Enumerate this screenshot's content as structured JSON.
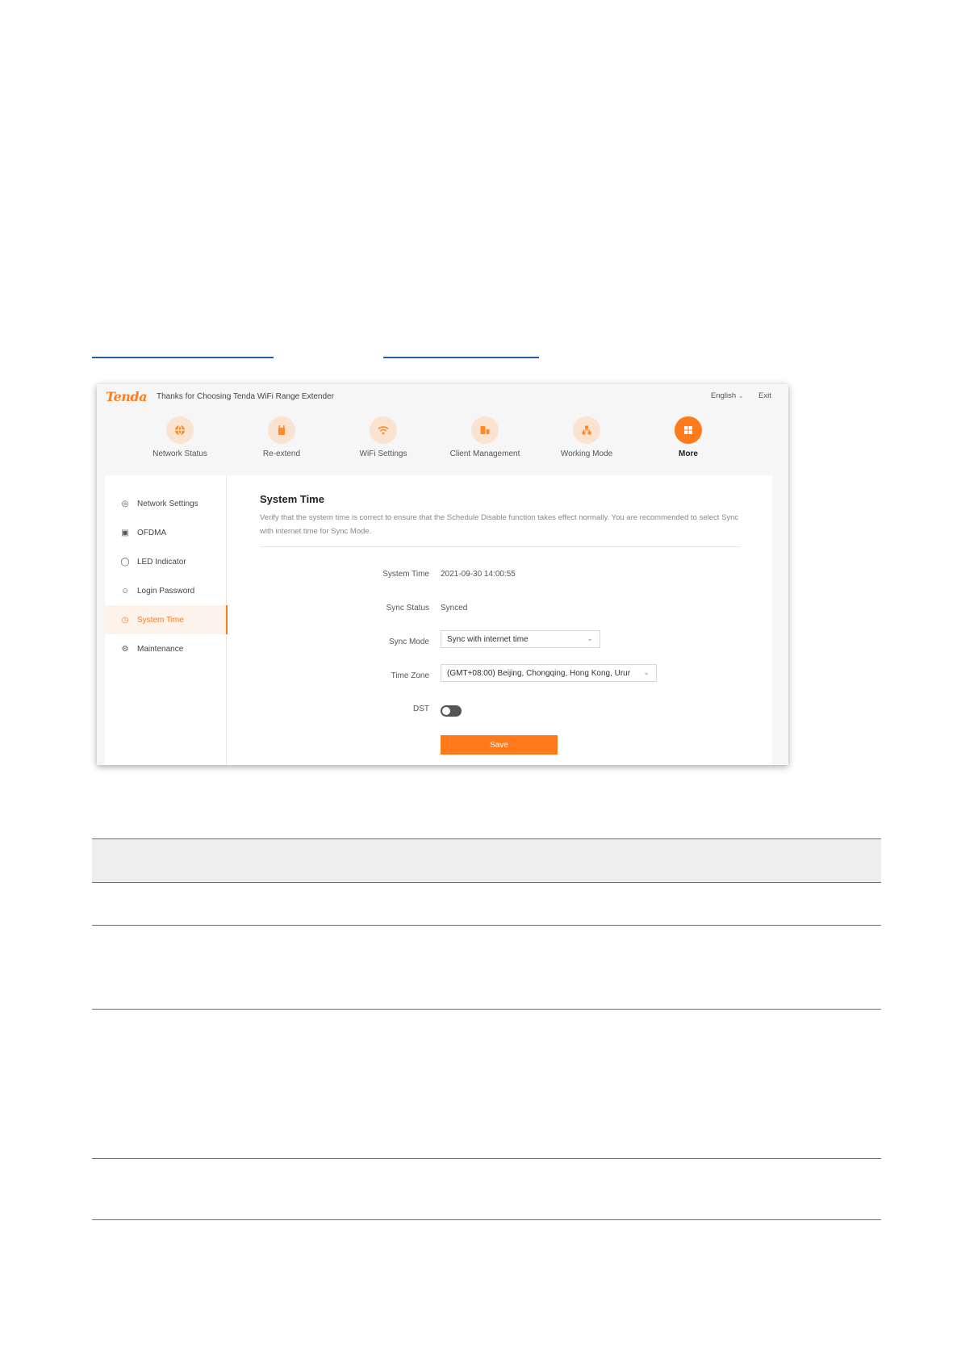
{
  "app": {
    "logo": "Tenda",
    "tagline": "Thanks for Choosing Tenda WiFi Range Extender",
    "language": "English",
    "exit_label": "Exit"
  },
  "nav": {
    "items": [
      {
        "label": "Network Status",
        "icon": "globe-icon"
      },
      {
        "label": "Re-extend",
        "icon": "extender-icon"
      },
      {
        "label": "WiFi Settings",
        "icon": "wifi-icon"
      },
      {
        "label": "Client Management",
        "icon": "client-icon"
      },
      {
        "label": "Working Mode",
        "icon": "mode-icon"
      },
      {
        "label": "More",
        "icon": "grid-icon",
        "active": true
      }
    ]
  },
  "sidebar": {
    "items": [
      {
        "label": "Network Settings",
        "icon": "globe-icon"
      },
      {
        "label": "OFDMA",
        "icon": "ofdma-icon"
      },
      {
        "label": "LED Indicator",
        "icon": "led-icon"
      },
      {
        "label": "Login Password",
        "icon": "user-lock-icon"
      },
      {
        "label": "System Time",
        "icon": "clock-icon",
        "active": true
      },
      {
        "label": "Maintenance",
        "icon": "gear-icon"
      }
    ]
  },
  "content": {
    "title": "System Time",
    "description": "Verify that the system time is correct to ensure that the Schedule Disable function takes effect normally. You are recommended to select Sync with internet time for Sync Mode.",
    "system_time_label": "System Time",
    "system_time_value": "2021-09-30 14:00:55",
    "sync_status_label": "Sync Status",
    "sync_status_value": "Synced",
    "sync_mode_label": "Sync Mode",
    "sync_mode_value": "Sync with internet time",
    "time_zone_label": "Time Zone",
    "time_zone_value": "(GMT+08:00) Beijing, Chongqing, Hong Kong, Urur",
    "dst_label": "DST",
    "dst_on": false,
    "save_label": "Save"
  },
  "colors": {
    "accent": "#ff7a1a",
    "link_underline": "#1f5fa8"
  }
}
